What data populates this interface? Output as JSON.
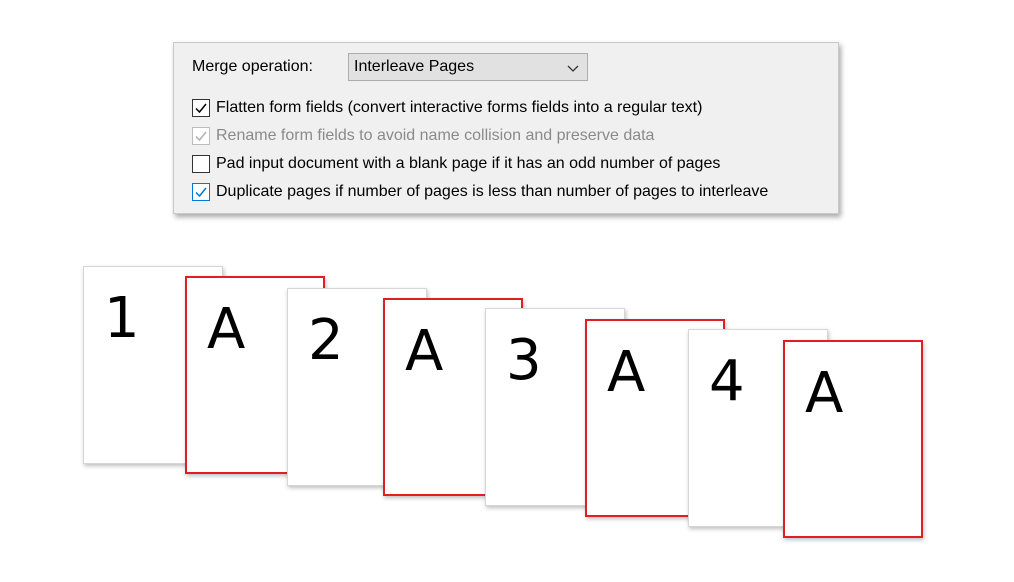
{
  "merge": {
    "label": "Merge operation:",
    "selected": "Interleave Pages"
  },
  "options": [
    {
      "label": "Flatten form fields (convert interactive forms fields into a regular text)",
      "checked": true,
      "enabled": true
    },
    {
      "label": "Rename form fields to avoid name collision and preserve data",
      "checked": true,
      "enabled": false
    },
    {
      "label": "Pad input document with a blank page if it has an odd number of pages",
      "checked": false,
      "enabled": true
    },
    {
      "label": "Duplicate pages if number of pages is less than number of pages to interleave",
      "checked": true,
      "enabled": true
    }
  ],
  "pages": [
    "1",
    "A",
    "2",
    "A",
    "3",
    "A",
    "4",
    "A"
  ],
  "colors": {
    "accent": "#0078d7",
    "duplicate_border": "#e02020"
  },
  "icons": {
    "dropdown": "chevron-down-icon",
    "check": "checkmark-icon"
  }
}
